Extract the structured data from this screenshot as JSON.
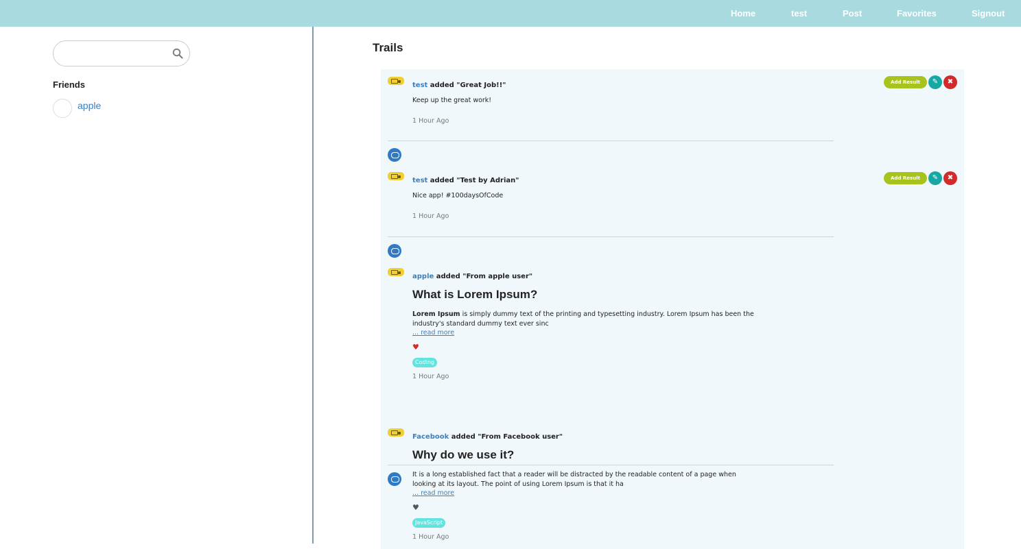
{
  "nav": {
    "home": "Home",
    "user": "test",
    "post": "Post",
    "favorites": "Favorites",
    "signout": "Signout"
  },
  "sidebar": {
    "search_placeholder": "",
    "friends_title": "Friends",
    "friends": [
      {
        "name": "apple"
      }
    ]
  },
  "main": {
    "title": "Trails",
    "actions": {
      "add_result": "Add Result",
      "edit_icon": "edit-icon",
      "delete_icon": "close-icon",
      "delete_glyph": "✖",
      "edit_glyph": "✎"
    },
    "items": [
      {
        "author": "test",
        "action": "added \"Great Job!!\"",
        "body": "Keep up the great work!",
        "time": "1 Hour Ago"
      },
      {
        "author": "test",
        "action": "added \"Test by Adrian\"",
        "body": "Nice app! #100daysOfCode",
        "time": "1 Hour Ago"
      },
      {
        "author": "apple",
        "action": "added \"From apple user\"",
        "title": "What is Lorem Ipsum?",
        "body_bold": "Lorem Ipsum",
        "body": " is simply dummy text of the printing and typesetting industry. Lorem Ipsum has been the industry's standard dummy text ever sinc",
        "read_more": "... read more",
        "heart": "♥",
        "liked": true,
        "tag": "Coding",
        "time": "1 Hour Ago"
      },
      {
        "author": "Facebook",
        "action": "added \"From Facebook user\"",
        "title": "Why do we use it?",
        "body": "It is a long established fact that a reader will be distracted by the readable content of a page when looking at its layout. The point of using Lorem Ipsum is that it ha",
        "read_more": "... read more",
        "heart": "♥",
        "liked": false,
        "tag": "JavaScript",
        "time": "1 Hour Ago"
      }
    ]
  },
  "colors": {
    "navbar": "#a8dae0",
    "link": "#3a7fbf",
    "badge": "#f0cf34",
    "add_result": "#a8c41c",
    "edit": "#18a8a4",
    "delete": "#d12b2b",
    "tag": "#5fe4e0",
    "heart_liked": "#d12b2b",
    "heart_unliked": "#555555"
  }
}
